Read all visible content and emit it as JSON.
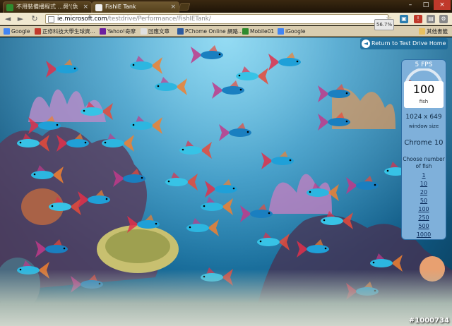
{
  "tabs": [
    {
      "label": "不用裝備播程式 ...舜'(魚",
      "favicon_color": "#2e8b2e"
    },
    {
      "label": "FishIE Tank",
      "favicon_color": "#f0f0f0"
    }
  ],
  "window_controls": {
    "minimize": "–",
    "maximize": "□",
    "close": "×"
  },
  "toolbar": {
    "back": "◄",
    "forward": "►",
    "reload": "↻"
  },
  "address": {
    "host": "ie.microsoft.com",
    "path": "/testdrive/Performance/FishIETank/"
  },
  "zoom_tip": "56.7%",
  "bookmarks": [
    {
      "label": "Google",
      "color": "#4285f4"
    },
    {
      "label": "正修科技大學生球資...",
      "color": "#c0392b"
    },
    {
      "label": "Yahoo!奇摩",
      "color": "#6b1fa0"
    },
    {
      "label": "回應文章",
      "color": "#e0e0e0"
    },
    {
      "label": "PChome Online 網路...",
      "color": "#2c5aa0"
    },
    {
      "label": "Mobile01",
      "color": "#2e8b2e"
    },
    {
      "label": "iGoogle",
      "color": "#4285f4"
    },
    {
      "label": "其他書籤",
      "color": "#e8c060"
    }
  ],
  "page": {
    "return_label": "Return to Test Drive Home",
    "fps": "5 FPS",
    "fish_count": "100",
    "fish_label": "fish",
    "window_dims": "1024 x 649",
    "window_label": "window size",
    "browser": "Chrome 10",
    "choose_label": "Choose number of fish",
    "fish_options": [
      "1",
      "10",
      "20",
      "50",
      "100",
      "250",
      "500",
      "1000"
    ]
  },
  "watermark": "#1000734",
  "colors": {
    "accent": "#2e6fa5",
    "gauge_needle": "#c0392b"
  }
}
